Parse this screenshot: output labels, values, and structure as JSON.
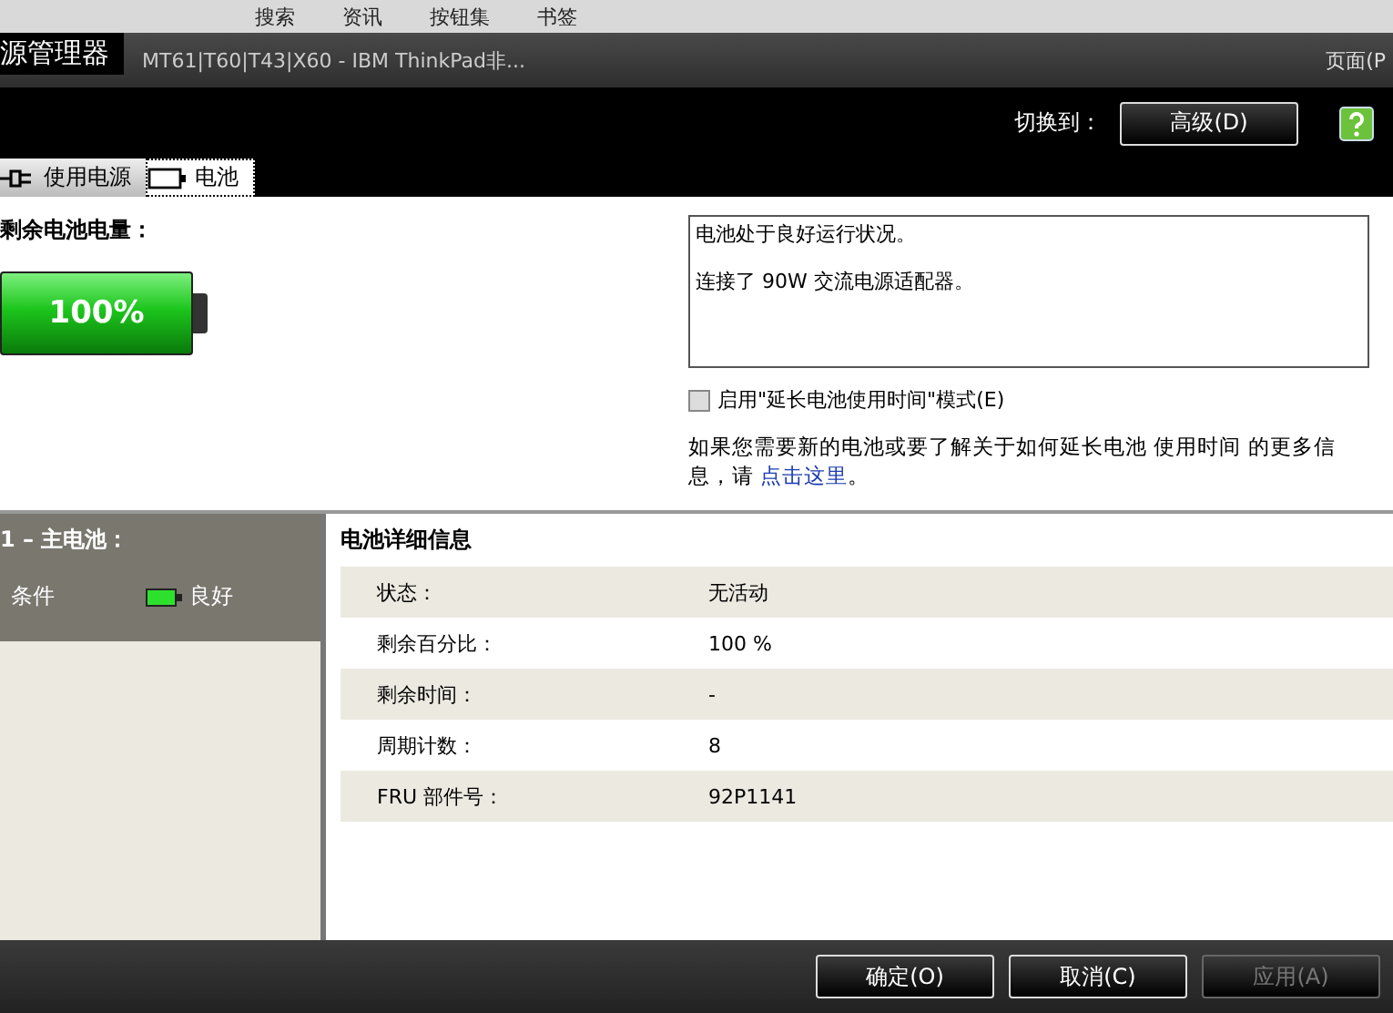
{
  "browser": {
    "toolbar": [
      "搜索",
      "资讯",
      "按钮集",
      "书签"
    ],
    "tab_title": "MT61|T60|T43|X60 - IBM ThinkPad非...",
    "page_menu": "页面(P"
  },
  "window": {
    "title": "源管理器"
  },
  "header": {
    "switch_label": "切换到：",
    "advanced_button": "高级(D)"
  },
  "tabs": [
    {
      "label": "使用电源",
      "kind": "plug",
      "selected": false
    },
    {
      "label": "电池",
      "kind": "battery",
      "selected": true
    }
  ],
  "charge": {
    "label": "剩余电池电量：",
    "percent": "100%",
    "level": 1
  },
  "status_box": [
    "电池处于良好运行状况。",
    "连接了 90W 交流电源适配器。"
  ],
  "extend_mode": {
    "label": "启用\"延长电池使用时间\"模式(E)",
    "checked": false
  },
  "info_text": {
    "text": "如果您需要新的电池或要了解关于如何延长电池 使用时间 的更多信息，请 ",
    "link": "点击这里",
    "end": "。"
  },
  "battery_panel": {
    "title": "1 – 主电池：",
    "condition_label": "条件",
    "condition_value": "良好"
  },
  "details": {
    "title": "电池详细信息",
    "rows": [
      {
        "label": "状态：",
        "value": "无活动"
      },
      {
        "label": "剩余百分比：",
        "value": "100 %"
      },
      {
        "label": "剩余时间：",
        "value": "-"
      },
      {
        "label": "周期计数：",
        "value": "8"
      },
      {
        "label": "FRU 部件号：",
        "value": "92P1141"
      }
    ]
  },
  "buttons": [
    {
      "label": "确定(O)",
      "disabled": false
    },
    {
      "label": "取消(C)",
      "disabled": false
    },
    {
      "label": "应用(A)",
      "disabled": true
    }
  ]
}
